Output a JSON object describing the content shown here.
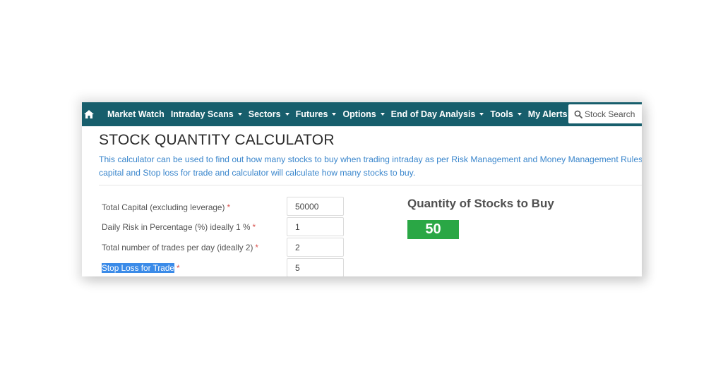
{
  "navbar": {
    "home_icon": "home-icon",
    "items": [
      {
        "label": "Market Watch",
        "dropdown": false
      },
      {
        "label": "Intraday Scans",
        "dropdown": true
      },
      {
        "label": "Sectors",
        "dropdown": true
      },
      {
        "label": "Futures",
        "dropdown": true
      },
      {
        "label": "Options",
        "dropdown": true
      },
      {
        "label": "End of Day Analysis",
        "dropdown": true
      },
      {
        "label": "Tools",
        "dropdown": true
      },
      {
        "label": "My Alerts",
        "dropdown": false
      }
    ],
    "search_placeholder": "Stock Search",
    "search_icon": "search-icon",
    "bg_color": "#175e6c"
  },
  "page": {
    "title": "STOCK QUANTITY CALCULATOR",
    "description_line1": "This calculator can be used to find out how many stocks to buy when trading intraday as per Risk Management and Money Management Rules. Just e",
    "description_line2": "capital and Stop loss for trade and calculator will calculate how many stocks to buy."
  },
  "form": {
    "required_mark": "*",
    "fields": [
      {
        "label": "Total Capital (excluding leverage)",
        "value": "50000"
      },
      {
        "label": "Daily Risk in Percentage (%) ideally 1 %",
        "value": "1"
      },
      {
        "label": "Total number of trades per day (ideally 2)",
        "value": "2"
      },
      {
        "label": "Stop Loss for Trade",
        "value": "5",
        "selected": true
      }
    ]
  },
  "result": {
    "title": "Quantity of Stocks to Buy",
    "value": "50",
    "color": "#2aa745"
  }
}
